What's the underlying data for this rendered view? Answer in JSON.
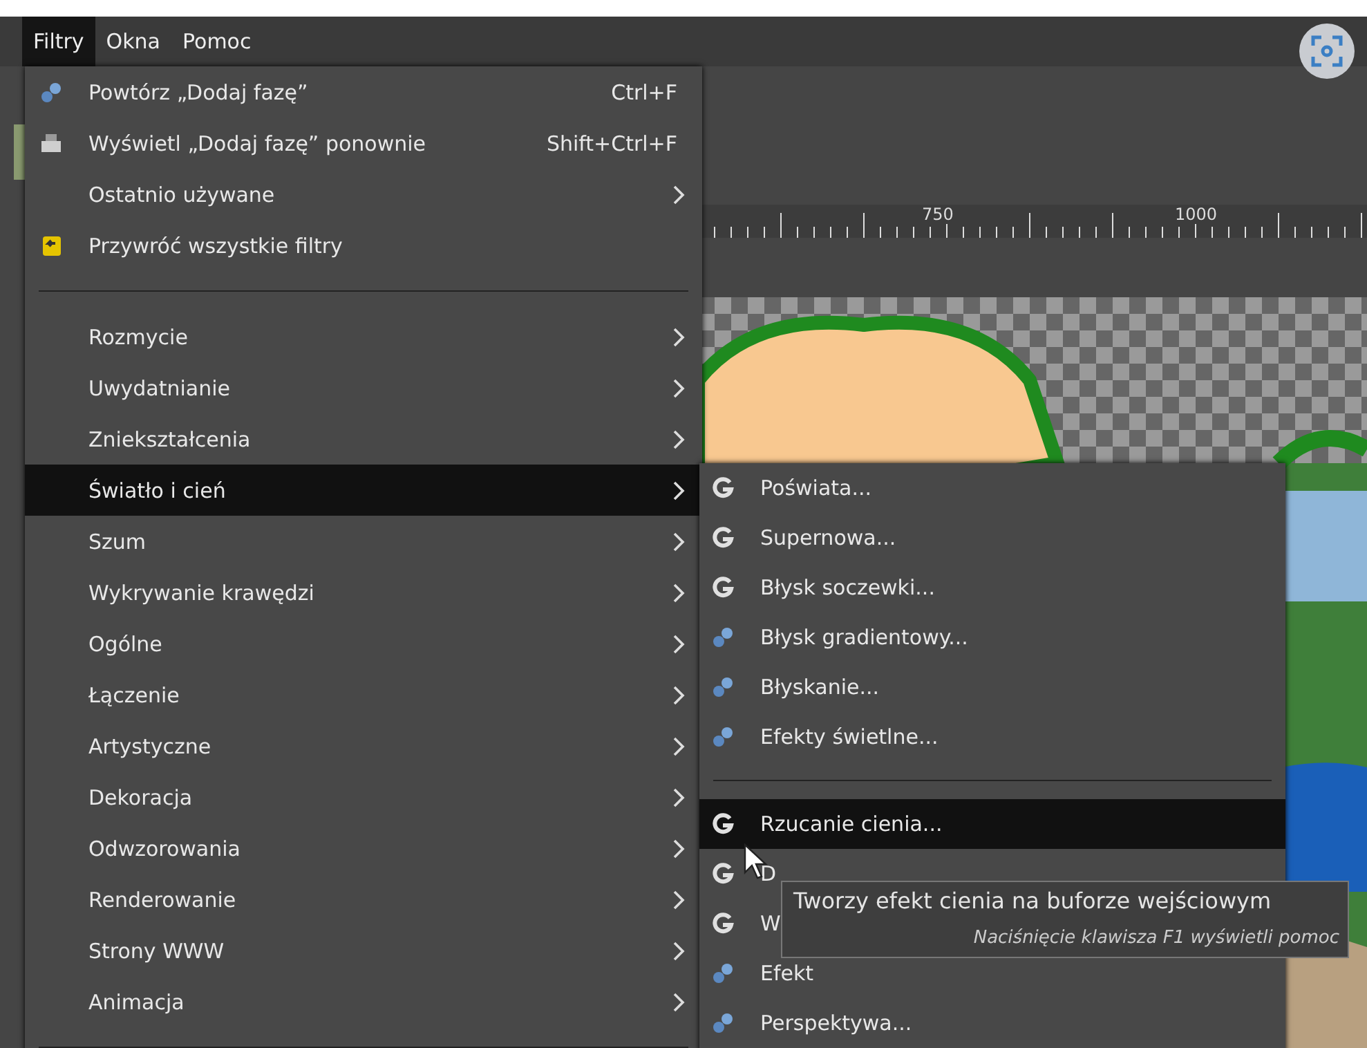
{
  "menubar": [
    {
      "label": "Filtry",
      "selected": true
    },
    {
      "label": "Okna",
      "selected": false
    },
    {
      "label": "Pomoc",
      "selected": false
    }
  ],
  "ruler": {
    "labels": [
      "750",
      "1000"
    ]
  },
  "filters_menu": [
    {
      "kind": "script",
      "label": "Powtórz „Dodaj fazę”",
      "shortcut": "Ctrl+F",
      "submenu": false,
      "selected": false
    },
    {
      "kind": "reshow",
      "label": "Wyświetl „Dodaj fazę” ponownie",
      "shortcut": "Shift+Ctrl+F",
      "submenu": false,
      "selected": false
    },
    {
      "kind": "plain",
      "label": "Ostatnio używane",
      "submenu": true,
      "selected": false
    },
    {
      "kind": "reset",
      "label": "Przywróć wszystkie filtry",
      "submenu": false,
      "selected": false
    },
    {
      "kind": "separator"
    },
    {
      "kind": "plain",
      "label": "Rozmycie",
      "submenu": true,
      "selected": false
    },
    {
      "kind": "plain",
      "label": "Uwydatnianie",
      "submenu": true,
      "selected": false
    },
    {
      "kind": "plain",
      "label": "Zniekształcenia",
      "submenu": true,
      "selected": false
    },
    {
      "kind": "plain",
      "label": "Światło i cień",
      "submenu": true,
      "selected": true
    },
    {
      "kind": "plain",
      "label": "Szum",
      "submenu": true,
      "selected": false
    },
    {
      "kind": "plain",
      "label": "Wykrywanie krawędzi",
      "submenu": true,
      "selected": false
    },
    {
      "kind": "plain",
      "label": "Ogólne",
      "submenu": true,
      "selected": false
    },
    {
      "kind": "plain",
      "label": "Łączenie",
      "submenu": true,
      "selected": false
    },
    {
      "kind": "plain",
      "label": "Artystyczne",
      "submenu": true,
      "selected": false
    },
    {
      "kind": "plain",
      "label": "Dekoracja",
      "submenu": true,
      "selected": false
    },
    {
      "kind": "plain",
      "label": "Odwzorowania",
      "submenu": true,
      "selected": false
    },
    {
      "kind": "plain",
      "label": "Renderowanie",
      "submenu": true,
      "selected": false
    },
    {
      "kind": "plain",
      "label": "Strony WWW",
      "submenu": true,
      "selected": false
    },
    {
      "kind": "plain",
      "label": "Animacja",
      "submenu": true,
      "selected": false
    },
    {
      "kind": "separator"
    }
  ],
  "light_shadow_menu": [
    {
      "kind": "gegl",
      "label": "Poświata...",
      "selected": false
    },
    {
      "kind": "gegl",
      "label": "Supernowa...",
      "selected": false
    },
    {
      "kind": "gegl",
      "label": "Błysk soczewki...",
      "selected": false
    },
    {
      "kind": "script",
      "label": "Błysk gradientowy...",
      "selected": false
    },
    {
      "kind": "script",
      "label": "Błyskanie...",
      "selected": false
    },
    {
      "kind": "script",
      "label": "Efekty świetlne...",
      "selected": false
    },
    {
      "kind": "separator"
    },
    {
      "kind": "gegl",
      "label": "Rzucanie cienia...",
      "selected": true
    },
    {
      "kind": "gegl",
      "label": "D",
      "selected": false
    },
    {
      "kind": "gegl",
      "label": "W",
      "selected": false
    },
    {
      "kind": "script",
      "label": "Efekt",
      "selected": false
    },
    {
      "kind": "script",
      "label": "Perspektywa...",
      "selected": false
    }
  ],
  "tooltip": {
    "text": "Tworzy efekt cienia na buforze wejściowym",
    "hint": "Naciśnięcie klawisza F1 wyświetli pomoc"
  }
}
